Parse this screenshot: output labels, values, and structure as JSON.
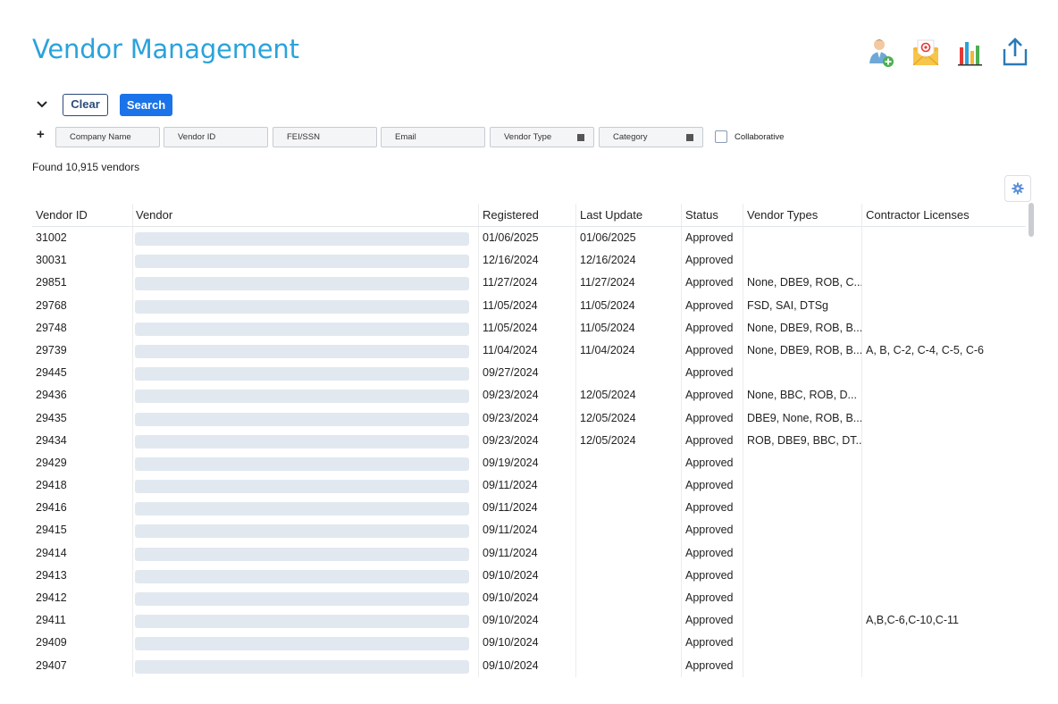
{
  "page": {
    "title": "Vendor Management"
  },
  "toolbar_icons": [
    "add-user-icon",
    "email-icon",
    "bar-chart-icon",
    "export-icon"
  ],
  "search": {
    "clear_label": "Clear",
    "search_label": "Search",
    "plus_label": "+",
    "filters": {
      "company_name": "Company Name",
      "vendor_id": "Vendor ID",
      "fei_ssn": "FEI/SSN",
      "email": "Email",
      "vendor_type": "Vendor Type",
      "category": "Category"
    },
    "collaborative_label": "Collaborative"
  },
  "results": {
    "found_text": "Found 10,915 vendors"
  },
  "table": {
    "columns": [
      "Vendor ID",
      "Vendor",
      "Registered",
      "Last Update",
      "Status",
      "Vendor Types",
      "Contractor Licenses"
    ],
    "rows": [
      {
        "id": "31002",
        "registered": "01/06/2025",
        "last_update": "01/06/2025",
        "status": "Approved",
        "types": "",
        "licenses": ""
      },
      {
        "id": "30031",
        "registered": "12/16/2024",
        "last_update": "12/16/2024",
        "status": "Approved",
        "types": "",
        "licenses": ""
      },
      {
        "id": "29851",
        "registered": "11/27/2024",
        "last_update": "11/27/2024",
        "status": "Approved",
        "types": "None, DBE9, ROB, C...",
        "licenses": ""
      },
      {
        "id": "29768",
        "registered": "11/05/2024",
        "last_update": "11/05/2024",
        "status": "Approved",
        "types": "FSD, SAI, DTSg",
        "licenses": ""
      },
      {
        "id": "29748",
        "registered": "11/05/2024",
        "last_update": "11/05/2024",
        "status": "Approved",
        "types": "None, DBE9, ROB, B...",
        "licenses": ""
      },
      {
        "id": "29739",
        "registered": "11/04/2024",
        "last_update": "11/04/2024",
        "status": "Approved",
        "types": "None, DBE9, ROB, B...",
        "licenses": "A, B, C-2, C-4, C-5, C-6"
      },
      {
        "id": "29445",
        "registered": "09/27/2024",
        "last_update": "",
        "status": "Approved",
        "types": "",
        "licenses": ""
      },
      {
        "id": "29436",
        "registered": "09/23/2024",
        "last_update": "12/05/2024",
        "status": "Approved",
        "types": "None, BBC, ROB, D...",
        "licenses": ""
      },
      {
        "id": "29435",
        "registered": "09/23/2024",
        "last_update": "12/05/2024",
        "status": "Approved",
        "types": "DBE9, None, ROB, B...",
        "licenses": ""
      },
      {
        "id": "29434",
        "registered": "09/23/2024",
        "last_update": "12/05/2024",
        "status": "Approved",
        "types": "ROB, DBE9, BBC, DT...",
        "licenses": ""
      },
      {
        "id": "29429",
        "registered": "09/19/2024",
        "last_update": "",
        "status": "Approved",
        "types": "",
        "licenses": ""
      },
      {
        "id": "29418",
        "registered": "09/11/2024",
        "last_update": "",
        "status": "Approved",
        "types": "",
        "licenses": ""
      },
      {
        "id": "29416",
        "registered": "09/11/2024",
        "last_update": "",
        "status": "Approved",
        "types": "",
        "licenses": ""
      },
      {
        "id": "29415",
        "registered": "09/11/2024",
        "last_update": "",
        "status": "Approved",
        "types": "",
        "licenses": ""
      },
      {
        "id": "29414",
        "registered": "09/11/2024",
        "last_update": "",
        "status": "Approved",
        "types": "",
        "licenses": ""
      },
      {
        "id": "29413",
        "registered": "09/10/2024",
        "last_update": "",
        "status": "Approved",
        "types": "",
        "licenses": ""
      },
      {
        "id": "29412",
        "registered": "09/10/2024",
        "last_update": "",
        "status": "Approved",
        "types": "",
        "licenses": ""
      },
      {
        "id": "29411",
        "registered": "09/10/2024",
        "last_update": "",
        "status": "Approved",
        "types": "",
        "licenses": "A,B,C-6,C-10,C-11"
      },
      {
        "id": "29409",
        "registered": "09/10/2024",
        "last_update": "",
        "status": "Approved",
        "types": "",
        "licenses": ""
      },
      {
        "id": "29407",
        "registered": "09/10/2024",
        "last_update": "",
        "status": "Approved",
        "types": "",
        "licenses": ""
      }
    ]
  },
  "colors": {
    "title": "#2aa3db",
    "search_button": "#1a73e8",
    "clear_border": "#2c4a7a",
    "vendor_placeholder": "#e1e8f0"
  }
}
